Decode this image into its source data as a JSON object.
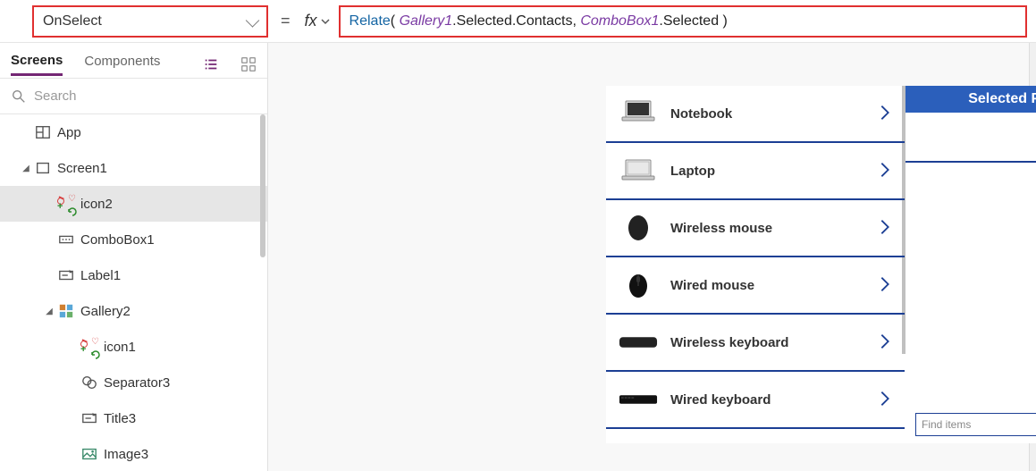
{
  "formula_bar": {
    "property": "OnSelect",
    "equals": "=",
    "fx_label": "fx",
    "formula_tokens": [
      {
        "t": "fn",
        "v": "Relate"
      },
      {
        "t": "plain",
        "v": "( "
      },
      {
        "t": "id",
        "v": "Gallery1"
      },
      {
        "t": "plain",
        "v": ".Selected.Contacts"
      },
      {
        "t": "comma",
        "v": ", "
      },
      {
        "t": "id",
        "v": "ComboBox1"
      },
      {
        "t": "plain",
        "v": ".Selected )"
      }
    ]
  },
  "left_panel": {
    "tabs": {
      "screens": "Screens",
      "components": "Components"
    },
    "search_placeholder": "Search",
    "tree": [
      {
        "id": "app",
        "label": "App",
        "depth": 0,
        "icon": "app",
        "caret": ""
      },
      {
        "id": "screen1",
        "label": "Screen1",
        "depth": 0,
        "icon": "screen",
        "caret": "down"
      },
      {
        "id": "icon2",
        "label": "icon2",
        "depth": 1,
        "icon": "iconstack",
        "caret": "",
        "selected": true
      },
      {
        "id": "combobox1",
        "label": "ComboBox1",
        "depth": 1,
        "icon": "combobox",
        "caret": ""
      },
      {
        "id": "label1",
        "label": "Label1",
        "depth": 1,
        "icon": "label",
        "caret": ""
      },
      {
        "id": "gallery2",
        "label": "Gallery2",
        "depth": 1,
        "icon": "gallery",
        "caret": "down"
      },
      {
        "id": "icon1",
        "label": "icon1",
        "depth": 2,
        "icon": "iconstack",
        "caret": ""
      },
      {
        "id": "separator3",
        "label": "Separator3",
        "depth": 2,
        "icon": "separator",
        "caret": ""
      },
      {
        "id": "title3",
        "label": "Title3",
        "depth": 2,
        "icon": "label",
        "caret": ""
      },
      {
        "id": "image3",
        "label": "Image3",
        "depth": 2,
        "icon": "image",
        "caret": ""
      }
    ]
  },
  "canvas": {
    "gallery_items": [
      {
        "title": "Notebook",
        "thumb": "laptop-open"
      },
      {
        "title": "Laptop",
        "thumb": "laptop-closed"
      },
      {
        "title": "Wireless mouse",
        "thumb": "mouse-a"
      },
      {
        "title": "Wired mouse",
        "thumb": "mouse-b"
      },
      {
        "title": "Wireless keyboard",
        "thumb": "keyboard-a"
      },
      {
        "title": "Wired keyboard",
        "thumb": "keyboard-b"
      }
    ],
    "right_header": "Selected Product Contacts",
    "combo_placeholder": "Find items"
  },
  "colors": {
    "accent_red": "#e03030",
    "accent_purple": "#742774",
    "brand_blue": "#1c3f94",
    "header_blue": "#2b5fbb"
  }
}
